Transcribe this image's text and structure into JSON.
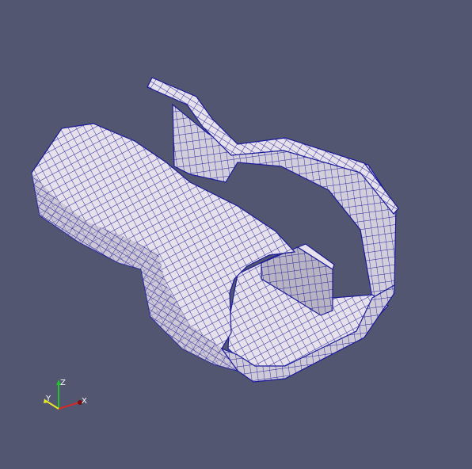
{
  "viewport": {
    "background_color": "#525670",
    "mesh": {
      "surface_color": "#e6e1ea",
      "shade_dark": "#b9b4c4",
      "shade_mid": "#d3cedb",
      "edge_color": "#1a1a9a",
      "wire_color": "#24249e"
    }
  },
  "orientation_axes": {
    "x_label": "X",
    "y_label": "Y",
    "z_label": "Z",
    "x_color": "#d42a2a",
    "y_color": "#e8e82a",
    "z_color": "#22c22a"
  }
}
